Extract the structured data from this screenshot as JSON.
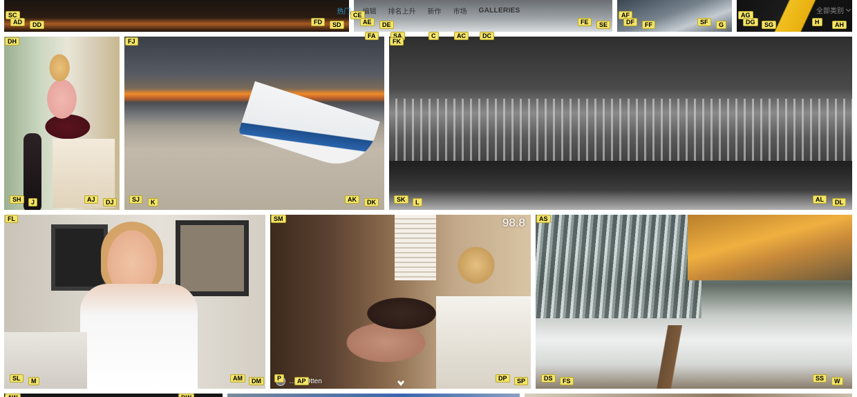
{
  "nav": {
    "items": [
      {
        "label": "热门",
        "active": true
      },
      {
        "label": "编辑"
      },
      {
        "label": "排名上升"
      },
      {
        "label": "新作"
      },
      {
        "label": "市场"
      },
      {
        "label": "GALLERIES",
        "bold": true
      }
    ],
    "filter_label": "全部类别",
    "filter_icon": "chevron-down-icon"
  },
  "photos": {
    "dancer": {
      "score": "98.8",
      "author": "…ny Otten"
    }
  },
  "hints": [
    "SC",
    "AD",
    "DD",
    "FD",
    "SD",
    "CE",
    "AE",
    "DE",
    "FE",
    "SE",
    "AF",
    "DF",
    "FF",
    "SF",
    "G",
    "AG",
    "DG",
    "SG",
    "H",
    "AH",
    "FA",
    "SA",
    "C",
    "AC",
    "DC",
    "FK",
    "DH",
    "FJ",
    "SH",
    "J",
    "AJ",
    "DJ",
    "SJ",
    "K",
    "AK",
    "DK",
    "SK",
    "L",
    "AL",
    "DL",
    "FL",
    "SM",
    "AS",
    "SL",
    "M",
    "AM",
    "DM",
    "P",
    "AP",
    "DP",
    "SP",
    "DS",
    "FS",
    "SS",
    "W",
    "AW",
    "DW"
  ],
  "colors": {
    "nav_active": "#2e9cd6",
    "hint_bg": "#f3e46a"
  }
}
